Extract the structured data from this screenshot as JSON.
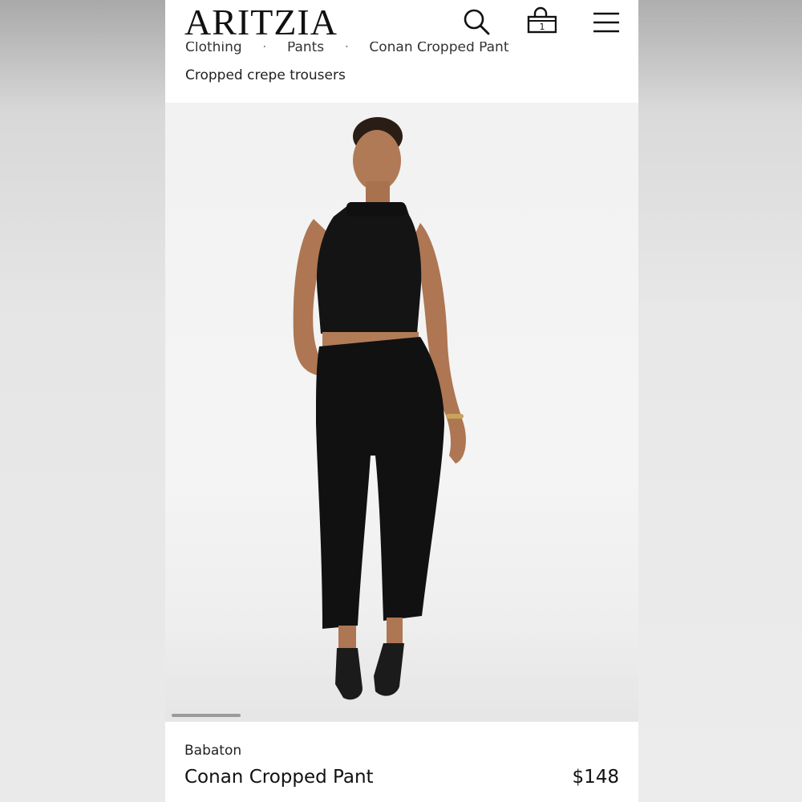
{
  "header": {
    "logo": "ARITZIA",
    "cart_count": "1"
  },
  "breadcrumb": {
    "items": [
      "Clothing",
      "Pants",
      "Conan Cropped Pant"
    ]
  },
  "subtitle": "Cropped crepe trousers",
  "product": {
    "brand": "Babaton",
    "name": "Conan Cropped Pant",
    "price": "$148"
  },
  "icons": {
    "search": "search-icon",
    "bag": "shopping-bag-icon",
    "menu": "hamburger-menu-icon"
  },
  "colors": {
    "text": "#111111",
    "background": "#ffffff",
    "photo_background": "#f2f2f2"
  }
}
